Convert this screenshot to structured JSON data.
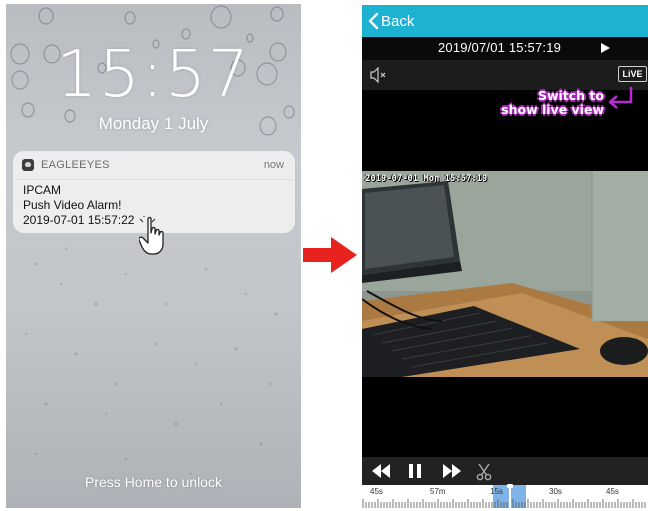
{
  "lock_screen": {
    "time": "15:57",
    "date": "Monday 1 July",
    "notification": {
      "app_name": "EAGLEEYES",
      "time": "now",
      "lines": [
        "IPCAM",
        "Push Video Alarm!",
        "2019-07-01 15:57:22"
      ]
    },
    "unlock_hint": "Press Home to unlock"
  },
  "playback": {
    "back_label": "Back",
    "datetime": "2019/07/01 15:57:19",
    "live_label": "LiVE",
    "callout": [
      "Switch to",
      "show live view"
    ],
    "video_osd": "2019-07-01 Mon 15:57:19",
    "timeline_labels": [
      "45s",
      "57m",
      "15s",
      "30s",
      "45s"
    ],
    "controls": [
      "rewind-icon",
      "pause-icon",
      "fast-forward-icon",
      "scissors-icon"
    ]
  },
  "colors": {
    "topbar": "#1eb2d2",
    "callout_outline": "#a826b8",
    "arrow": "#e8231f",
    "timeline_highlight": "#7fb2e6"
  }
}
